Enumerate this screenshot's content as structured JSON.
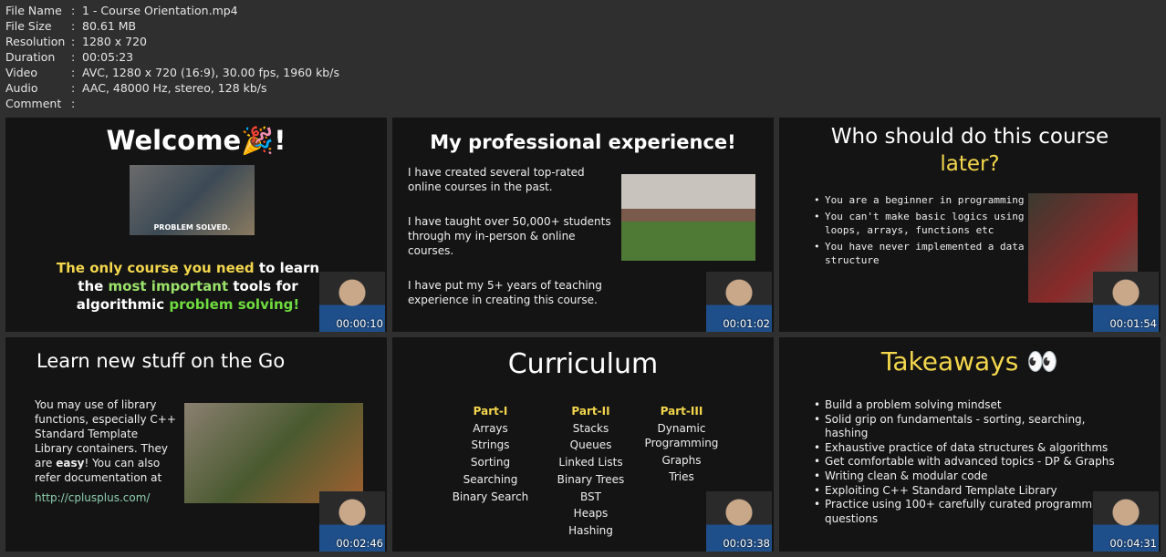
{
  "file_info": [
    {
      "key": "File Name",
      "value": "1 - Course Orientation.mp4"
    },
    {
      "key": "File Size",
      "value": "80.61 MB"
    },
    {
      "key": "Resolution",
      "value": "1280 x 720"
    },
    {
      "key": "Duration",
      "value": "00:05:23"
    },
    {
      "key": "Video",
      "value": "AVC, 1280 x 720 (16:9), 30.00 fps, 1960 kb/s"
    },
    {
      "key": "Audio",
      "value": "AAC, 48000 Hz, stereo, 128 kb/s"
    },
    {
      "key": "Comment",
      "value": ""
    }
  ],
  "separator": ":",
  "thumbs": [
    {
      "timestamp": "00:00:10",
      "title": "Welcome🎉!",
      "photo_caption": "PROBLEM SOLVED.",
      "line1a": "The only course you need",
      "line1b": " to learn",
      "line2a": "the ",
      "line2b": "most important",
      "line2c": " tools for",
      "line3a": "algorithmic ",
      "line3b": "problem solving!"
    },
    {
      "timestamp": "00:01:02",
      "title": "My professional experience!",
      "paragraphs": [
        "I have created several top-rated online courses in the past.",
        "I have taught over 50,000+ students through my in-person & online courses.",
        "I have put my 5+ years of teaching experience in creating this course."
      ]
    },
    {
      "timestamp": "00:01:54",
      "title1": "Who should do this course",
      "title2": "later?",
      "bullets": [
        "You are a beginner in programming",
        "You can't make basic logics using loops, arrays, functions etc",
        "You have never implemented a data structure"
      ]
    },
    {
      "timestamp": "00:02:46",
      "title": "Learn new stuff on the Go",
      "text1": "You may use of library functions, especially C++ Standard Template Library containers. They are ",
      "text_bold": "easy",
      "text2": "! You can also refer documentation at",
      "link": "http://cplusplus.com/"
    },
    {
      "timestamp": "00:03:38",
      "title": "Curriculum",
      "columns": [
        {
          "heading": "Part-I",
          "items": [
            "Arrays",
            "Strings",
            "Sorting",
            "Searching",
            "Binary Search"
          ]
        },
        {
          "heading": "Part-II",
          "items": [
            "Stacks",
            "Queues",
            "Linked Lists",
            "Binary Trees",
            "BST",
            "Heaps",
            "Hashing"
          ]
        },
        {
          "heading": "Part-III",
          "items": [
            "Dynamic Programming",
            "Graphs",
            "Tries"
          ]
        }
      ]
    },
    {
      "timestamp": "00:04:31",
      "title": "Takeaways 👀",
      "bullets": [
        "Build a problem solving mindset",
        "Solid grip on fundamentals - sorting, searching, hashing",
        "Exhaustive practice of data structures & algorithms",
        "Get comfortable with advanced topics - DP & Graphs",
        "Writing clean & modular code",
        "Exploiting C++ Standard Template Library",
        "Practice using 100+ carefully curated programming questions"
      ]
    }
  ]
}
